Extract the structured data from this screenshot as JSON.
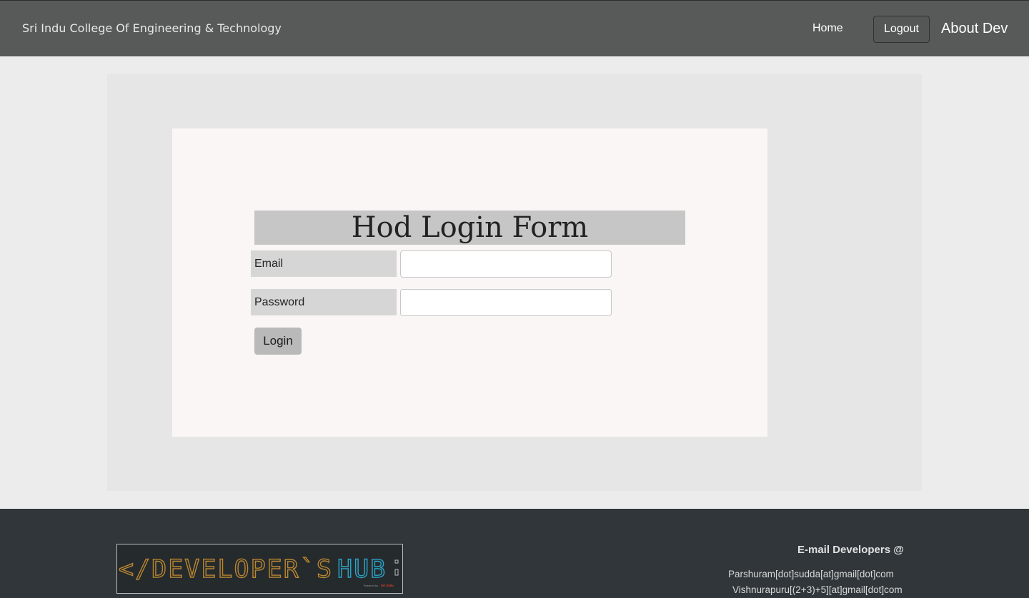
{
  "navbar": {
    "brand": "Sri Indu College Of Engineering & Technology",
    "home_label": "Home",
    "logout_label": "Logout",
    "about_label": "About Dev"
  },
  "form": {
    "title": "Hod Login Form",
    "email_label": "Email",
    "email_value": "",
    "password_label": "Password",
    "password_value": "",
    "login_label": "Login"
  },
  "footer": {
    "logo_text_main": "</DEVELOPER`S",
    "logo_text_hub": "HUB",
    "logo_sub_prefix": "Powered by",
    "logo_sub_brand": "Sri Indu",
    "contact_heading": "E-mail Developers @",
    "emails": [
      "Parshuram[dot]sudda[at]gmail[dot]com",
      "Vishnurapuru[(2+3)+5][at]gmail[dot]com"
    ]
  },
  "colors": {
    "navbar_bg": "#585a59",
    "footer_bg": "#30363a",
    "logo_orange": "#b9862f",
    "logo_blue": "#2aa6c8"
  }
}
